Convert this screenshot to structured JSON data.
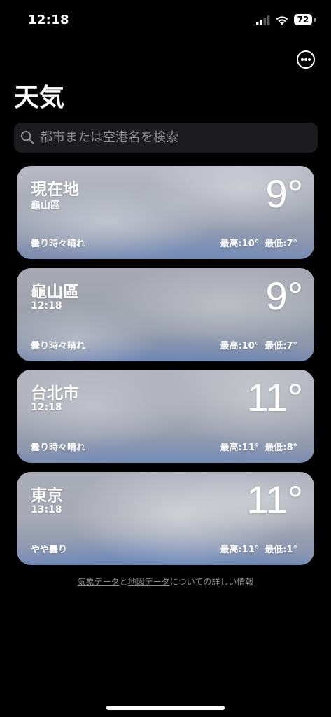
{
  "status_bar": {
    "time": "12:18",
    "battery": "72"
  },
  "header": {
    "title": "天気"
  },
  "search": {
    "placeholder": "都市または空港名を検索"
  },
  "cards": [
    {
      "name": "現在地",
      "subtitle": "龜山區",
      "temperature": "9°",
      "condition": "曇り時々晴れ",
      "high": "最高:10°",
      "low": "最低:7°"
    },
    {
      "name": "龜山區",
      "subtitle": "12:18",
      "temperature": "9°",
      "condition": "曇り時々晴れ",
      "high": "最高:10°",
      "low": "最低:7°"
    },
    {
      "name": "台北市",
      "subtitle": "12:18",
      "temperature": "11°",
      "condition": "曇り時々晴れ",
      "high": "最高:11°",
      "low": "最低:8°"
    },
    {
      "name": "東京",
      "subtitle": "13:18",
      "temperature": "11°",
      "condition": "やや曇り",
      "high": "最高:11°",
      "low": "最低:1°"
    }
  ],
  "footer": {
    "weather_data_link": "気象データ",
    "conjunction": "と",
    "map_data_link": "地図データ",
    "suffix": "についての詳しい情報"
  }
}
